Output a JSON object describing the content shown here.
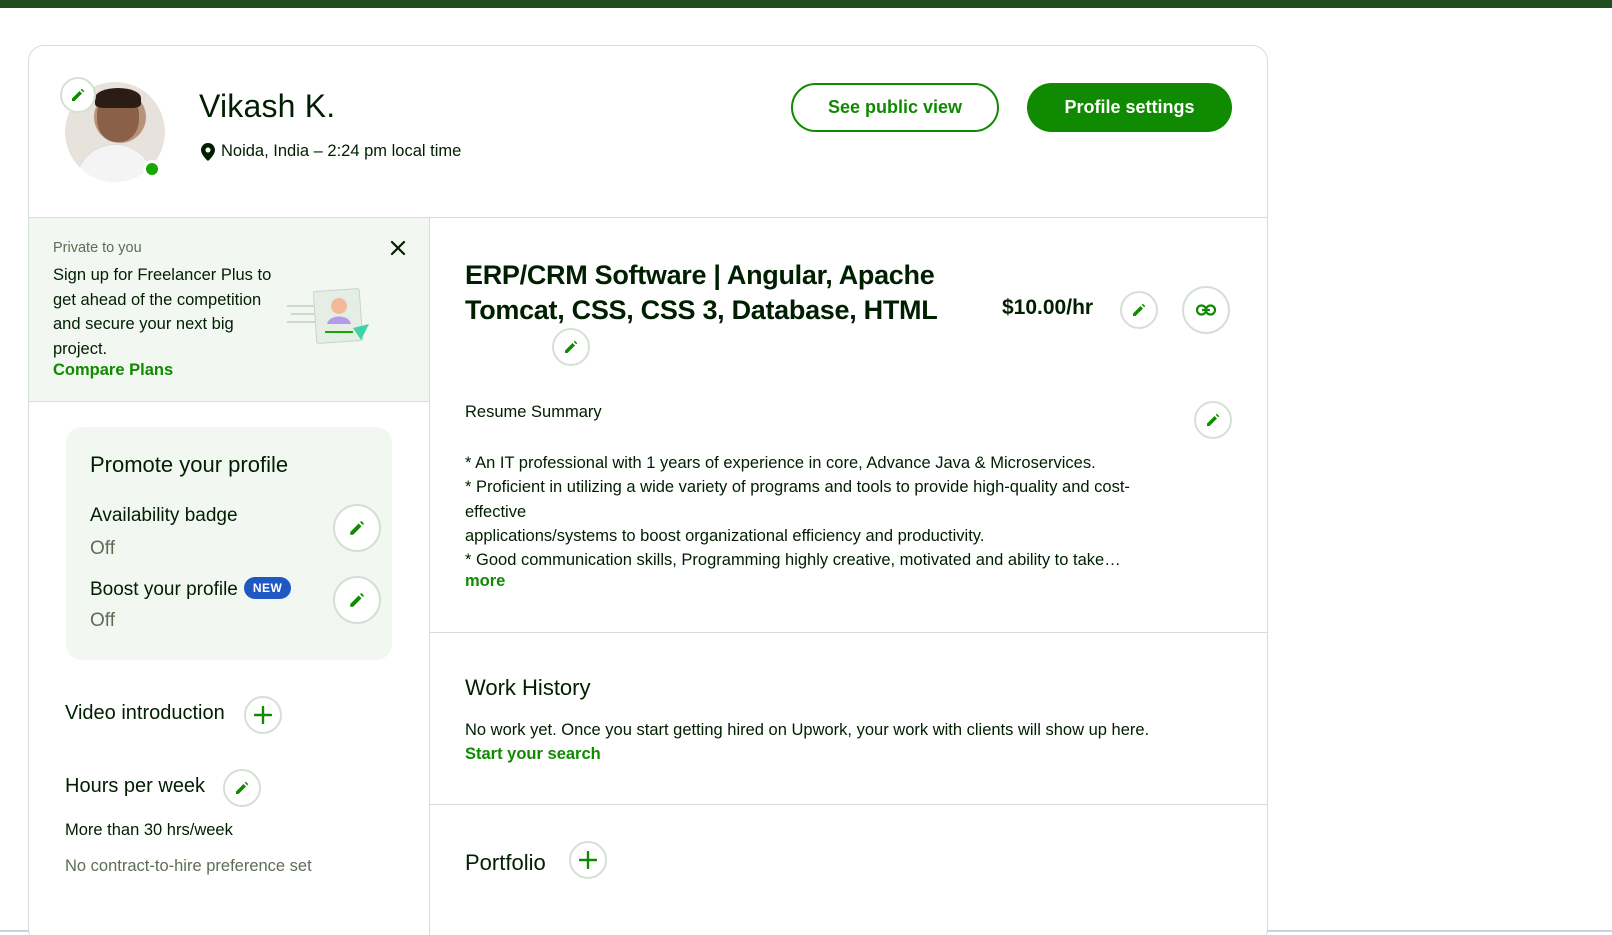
{
  "header": {
    "name": "Vikash K.",
    "location": "Noida, India – 2:24 pm local time",
    "see_public_view": "See public view",
    "profile_settings": "Profile settings"
  },
  "promo": {
    "private_label": "Private to you",
    "text": "Sign up for Freelancer Plus to get ahead of the competition and secure your next big project.",
    "link": "Compare Plans"
  },
  "promote": {
    "title": "Promote your profile",
    "availability_label": "Availability badge",
    "availability_value": "Off",
    "boost_label": "Boost your profile",
    "boost_badge": "NEW",
    "boost_value": "Off"
  },
  "sidebar": {
    "video_intro": "Video introduction",
    "hours_label": "Hours per week",
    "hours_value": "More than 30 hrs/week",
    "contract_pref": "No contract-to-hire preference set"
  },
  "main": {
    "title": "ERP/CRM Software | Angular, Apache Tomcat, CSS, CSS 3, Database, HTML",
    "rate": "$10.00/hr",
    "resume_label": "Resume Summary",
    "resume_lines": [
      "* An IT professional with 1 years of experience in core, Advance Java & Microservices.",
      "* Proficient in utilizing a wide variety of programs and tools to provide high-quality and cost-effective",
      "applications/systems to boost organizational efficiency and productivity.",
      "* Good communication skills, Programming highly creative, motivated and ability to take…"
    ],
    "more": "more",
    "work_history_title": "Work History",
    "work_history_text": "No work yet. Once you start getting hired on Upwork, your work with clients will show up here.",
    "work_history_link": "Start your search",
    "portfolio_title": "Portfolio"
  },
  "colors": {
    "brand_green": "#108a00",
    "online_green": "#14a800",
    "badge_blue": "#1f57c3"
  }
}
